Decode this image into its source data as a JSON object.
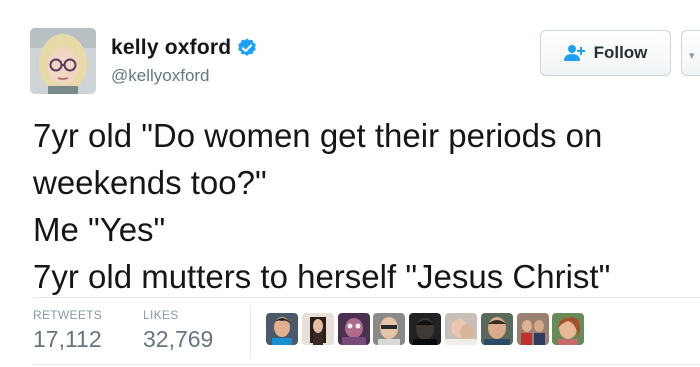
{
  "author": {
    "display_name": "kelly oxford",
    "handle": "@kellyoxford",
    "verified": true,
    "avatar_icon": "profile-photo"
  },
  "follow_button": {
    "label": "Follow",
    "icon": "add-user-icon"
  },
  "tweet": {
    "lines": [
      "7yr old \"Do women get their periods on",
      "weekends too?\"",
      "Me \"Yes\"",
      "7yr old mutters to herself \"Jesus Christ\""
    ]
  },
  "stats": {
    "retweets_label": "RETWEETS",
    "retweets_value": "17,112",
    "likes_label": "LIKES",
    "likes_value": "32,769"
  },
  "colors": {
    "text": "#14171a",
    "secondary": "#657786",
    "verified_blue": "#1da1f2",
    "border": "#e1e8ed"
  }
}
